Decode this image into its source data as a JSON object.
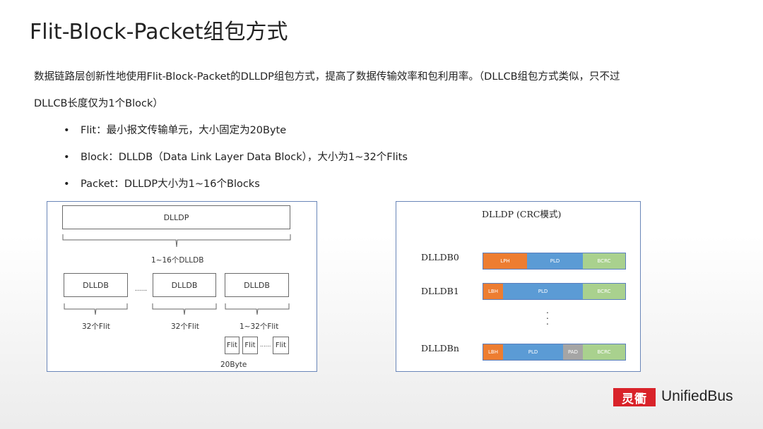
{
  "title": "Flit-Block-Packet组包方式",
  "intro": {
    "line1": "数据链路层创新性地使用Flit-Block-Packet的DLLDP组包方式，提高了数据传输效率和包利用率。（DLLCB组包方式类似，只不过",
    "line2": "DLLCB长度仅为1个Block）"
  },
  "bullets": [
    "Flit：最小报文传输单元，大小固定为20Byte",
    "Block：DLLDB（Data Link Layer Data Block），大小为1~32个Flits",
    "Packet：DLLDP大小为1~16个Blocks"
  ],
  "left_diagram": {
    "dlldp_label": "DLLDP",
    "dlldb_count_label": "1~16个DLLDB",
    "dlldb_label": "DLLDB",
    "ellipsis": "......",
    "flit_count_a": "32个Flit",
    "flit_count_b": "32个Flit",
    "flit_count_c": "1~32个Flit",
    "flit_label": "Flit",
    "flit_ellipsis": "......",
    "flit_size": "20Byte"
  },
  "right_diagram": {
    "title": "DLLDP (CRC模式)",
    "rows": [
      {
        "name": "DLLDB0",
        "head": "LPH",
        "pld": "PLD",
        "crc": "BCRC"
      },
      {
        "name": "DLLDB1",
        "head": "LBH",
        "pld": "PLD",
        "crc": "BCRC"
      },
      {
        "name": "DLLDBn",
        "head": "LBH",
        "pld": "PLD",
        "pad": "PAD",
        "crc": "BCRC"
      }
    ],
    "vdots": ".\n.\n."
  },
  "brand": {
    "mark": "灵衢",
    "name": "UnifiedBus",
    "colors": {
      "mark_bg": "#d9232a",
      "header_orange": "#ed7d31",
      "pld_blue": "#5b9bd5",
      "crc_green": "#a9d18e",
      "pad_gray": "#a5a5a5"
    }
  }
}
